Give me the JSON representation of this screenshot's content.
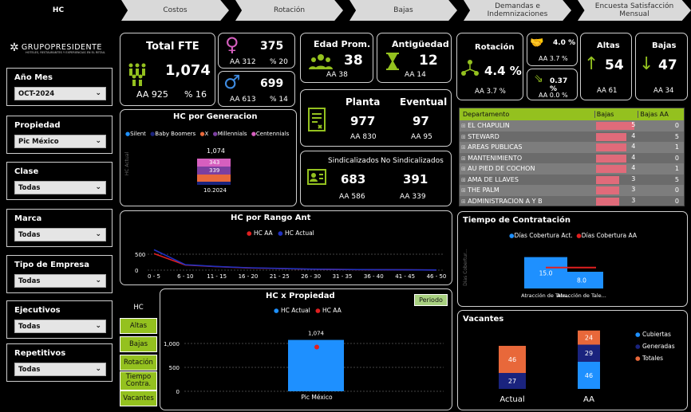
{
  "nav": [
    "HC",
    "Costos",
    "Rotación",
    "Bajas",
    "Demandas e Indemnizaciones",
    "Encuesta Satisfacción Mensual"
  ],
  "brand": {
    "name": "GRUPOPRESIDENTE",
    "tag": "HOTELES, RESTAURANTES Y EXPERIENCIAS EN EL RETAIL"
  },
  "filters": [
    {
      "label": "Año Mes",
      "value": "OCT-2024"
    },
    {
      "label": "Propiedad",
      "value": "Pic México"
    },
    {
      "label": "Clase",
      "value": "Todas"
    },
    {
      "label": "Marca",
      "value": "Todas"
    },
    {
      "label": "Tipo de Empresa",
      "value": "Todas"
    },
    {
      "label": "Ejecutivos",
      "value": "Todas"
    },
    {
      "label": "Repetitivos",
      "value": "Todas"
    }
  ],
  "fte": {
    "title": "Total FTE",
    "value": "1,074",
    "aa": "AA 925",
    "pct": "% 16"
  },
  "female": {
    "value": "375",
    "aa": "AA 312",
    "pct": "% 20"
  },
  "male": {
    "value": "699",
    "aa": "AA 613",
    "pct": "% 14"
  },
  "edad": {
    "title": "Edad Prom.",
    "value": "38",
    "aa": "AA 38"
  },
  "antiguedad": {
    "title": "Antigüedad",
    "value": "12",
    "aa": "AA 14"
  },
  "planta": {
    "title": "Planta",
    "value": "977",
    "aa": "AA 830"
  },
  "eventual": {
    "title": "Eventual",
    "value": "97",
    "aa": "AA 95"
  },
  "sind": {
    "title": "Sindicalizados",
    "value": "683",
    "aa": "AA 586"
  },
  "nosind": {
    "title": "No Sindicalizados",
    "value": "391",
    "aa": "AA 339"
  },
  "rotacion": {
    "title": "Rotación",
    "value": "4.4 %",
    "aa": "AA 3.7 %"
  },
  "rot_vol": {
    "value": "4.0 %",
    "aa": "AA 3.7 %"
  },
  "rot_inv": {
    "value": "0.37 %",
    "aa": "AA 0.0 %"
  },
  "altas": {
    "title": "Altas",
    "value": "54",
    "aa": "AA 61"
  },
  "bajas": {
    "title": "Bajas",
    "value": "47",
    "aa": "AA 34"
  },
  "generacion": {
    "title": "HC por Generacion",
    "legend": [
      "Silent",
      "Baby Boomers",
      "X",
      "Millennials",
      "Centennials"
    ],
    "total": "1,074",
    "seg1": "343",
    "seg2": "339",
    "xlabel": "10.2024",
    "ylabel": "HC Actual"
  },
  "dept": {
    "headers": [
      "Departamento",
      "Bajas",
      "Bajas AA"
    ],
    "rows": [
      {
        "name": "EL CHAPULIN",
        "bajas": "5",
        "aa": "0",
        "frac": 1.0
      },
      {
        "name": "STEWARD",
        "bajas": "4",
        "aa": "5",
        "frac": 0.8
      },
      {
        "name": "AREAS PUBLICAS",
        "bajas": "4",
        "aa": "1",
        "frac": 0.8
      },
      {
        "name": "MANTENIMIENTO",
        "bajas": "4",
        "aa": "0",
        "frac": 0.8
      },
      {
        "name": "AU PIED DE COCHON",
        "bajas": "4",
        "aa": "1",
        "frac": 0.8
      },
      {
        "name": "AMA DE LLAVES",
        "bajas": "3",
        "aa": "5",
        "frac": 0.6
      },
      {
        "name": "THE PALM",
        "bajas": "3",
        "aa": "0",
        "frac": 0.6
      },
      {
        "name": "ADMINISTRACION A Y B",
        "bajas": "3",
        "aa": "0",
        "frac": 0.6
      }
    ]
  },
  "rango": {
    "title": "HC por Rango Ant",
    "legend": [
      "HC AA",
      "HC Actual"
    ],
    "yticks": [
      "500",
      "0"
    ],
    "xticks": [
      "0 - 5",
      "6 - 10",
      "11 - 15",
      "16 - 20",
      "21 - 25",
      "26 - 30",
      "31 - 35",
      "36 - 40",
      "41 - 45",
      "46 - 50"
    ]
  },
  "tabs": [
    "HC",
    "Altas",
    "Bajas",
    "Rotación",
    "Tiempo Contra.",
    "Vacantes"
  ],
  "prop": {
    "title": "HC x Propiedad",
    "legend": [
      "HC Actual",
      "HC AA"
    ],
    "button": "Periodo",
    "yticks": [
      "1,000",
      "500",
      "0"
    ],
    "barlabel": "1,074",
    "category": "Pic México"
  },
  "contrat": {
    "title": "Tiempo de Contratación",
    "legend": [
      "Días Cobertura Act.",
      "Días Cobertura AA"
    ],
    "ylabel": "Dias Cobertur...",
    "bars": [
      {
        "value": "15.0",
        "label": "Atracción de Tale..."
      },
      {
        "value": "8.0",
        "label": "Atracción de Tale..."
      }
    ]
  },
  "vacantes": {
    "title": "Vacantes",
    "legend": [
      "Cubiertas",
      "Generadas",
      "Totales"
    ],
    "actual": {
      "label": "Actual",
      "totales": "46",
      "generadas": "27"
    },
    "aa": {
      "label": "AA",
      "totales": "24",
      "generadas": "29",
      "cubiertas": "46"
    }
  },
  "chart_data": [
    {
      "type": "bar",
      "title": "HC por Generacion",
      "categories": [
        "10.2024"
      ],
      "series": [
        {
          "name": "Millennials",
          "values": [
            343
          ]
        },
        {
          "name": "X",
          "values": [
            339
          ]
        }
      ],
      "total": 1074
    },
    {
      "type": "line",
      "title": "HC por Rango Ant",
      "categories": [
        "0 - 5",
        "6 - 10",
        "11 - 15",
        "16 - 20",
        "21 - 25",
        "26 - 30",
        "31 - 35",
        "36 - 40",
        "41 - 45",
        "46 - 50"
      ],
      "series": [
        {
          "name": "HC AA",
          "values": [
            520,
            160,
            110,
            70,
            50,
            30,
            20,
            15,
            10,
            5
          ]
        },
        {
          "name": "HC Actual",
          "values": [
            640,
            170,
            115,
            75,
            55,
            32,
            22,
            15,
            10,
            5
          ]
        }
      ],
      "ylim": [
        0,
        700
      ]
    },
    {
      "type": "bar",
      "title": "HC x Propiedad",
      "categories": [
        "Pic México"
      ],
      "series": [
        {
          "name": "HC Actual",
          "values": [
            1074
          ]
        },
        {
          "name": "HC AA",
          "values": [
            925
          ]
        }
      ],
      "ylim": [
        0,
        1300
      ]
    },
    {
      "type": "bar",
      "title": "Tiempo de Contratación",
      "categories": [
        "Atracción de Tale...",
        "Atracción de Tale..."
      ],
      "series": [
        {
          "name": "Días Cobertura Act.",
          "values": [
            15,
            8
          ]
        },
        {
          "name": "Días Cobertura AA",
          "values": [
            10,
            10
          ]
        }
      ]
    },
    {
      "type": "bar",
      "title": "Vacantes",
      "categories": [
        "Actual",
        "AA"
      ],
      "series": [
        {
          "name": "Cubiertas",
          "values": [
            0,
            46
          ]
        },
        {
          "name": "Generadas",
          "values": [
            27,
            29
          ]
        },
        {
          "name": "Totales",
          "values": [
            46,
            24
          ]
        }
      ]
    }
  ]
}
